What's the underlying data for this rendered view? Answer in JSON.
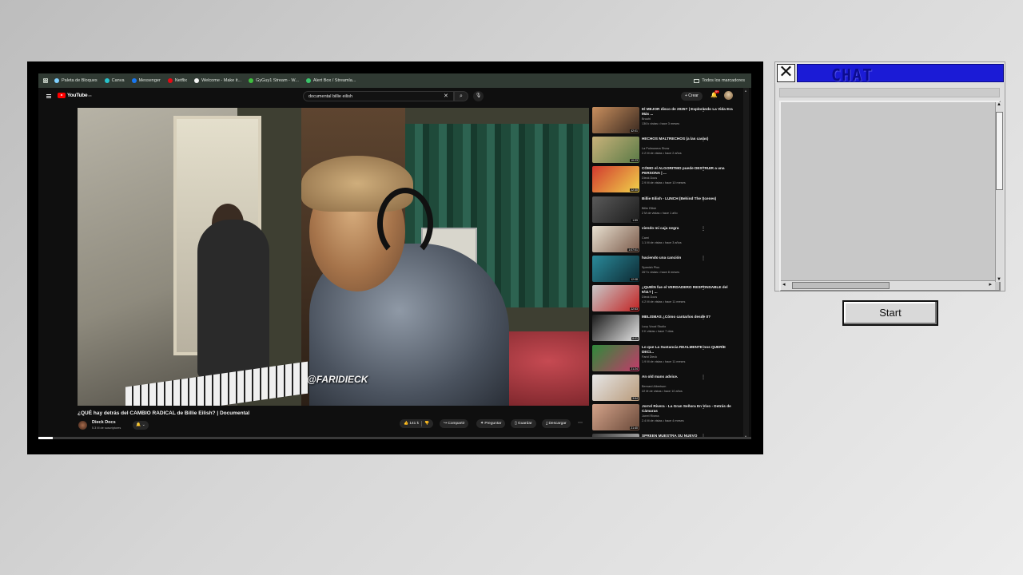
{
  "bookmarks": {
    "items": [
      {
        "label": "Paleta de Bloques",
        "color": "#7fd0ff"
      },
      {
        "label": "Canva",
        "color": "#27c3cc"
      },
      {
        "label": "Messenger",
        "color": "#1877f2"
      },
      {
        "label": "Netflix",
        "color": "#e50914"
      },
      {
        "label": "Welcome - Make it...",
        "color": "#f5f5f5"
      },
      {
        "label": "GyGuy1 Stream - W...",
        "color": "#3fbf3f"
      },
      {
        "label": "Alert Box / Streamla...",
        "color": "#39c56b"
      }
    ],
    "all_label": "Todos los marcadores"
  },
  "youtube": {
    "logo_text": "YouTube",
    "logo_region": "MX",
    "search_value": "documental billie eilish",
    "create_label": "+ Crear",
    "notif_count": "9+",
    "video": {
      "watermark": "@FARIDIECK",
      "title": "¿QUÉ hay detrás del CAMBIO RADICAL de Billie Eilish? | Documental",
      "channel": "Dieck Docs",
      "subscribers": "5.3 M de suscriptores",
      "likes": "141 k",
      "progress_percent": 2
    },
    "actions": {
      "share": "Compartir",
      "ask": "Preguntar",
      "save": "Guardar",
      "download": "Descargar"
    },
    "recommendations": [
      {
        "title": "El MEJOR disco de 2025? | Explorando La Vida Era Más ...",
        "channel": "Bruuhi",
        "meta": "136 k vistas • hace 3 meses",
        "duration": "42:01",
        "colors": [
          "#c98f5e",
          "#3b2a20"
        ]
      },
      {
        "title": "HECHOS MALTRECHOS (a las casas)",
        "channel": "La Pulmonera Show",
        "meta": "2.2 M de vistas • hace 2 años",
        "duration": "10:23",
        "colors": [
          "#c8b27a",
          "#5a7a46"
        ]
      },
      {
        "title": "CÓMO el ALGORITMO puede DESTRUIR a una PERSONA | ...",
        "channel": "Dieck Docs",
        "meta": "2.9 M de vistas • hace 10 meses",
        "duration": "22:30",
        "colors": [
          "#d23a2f",
          "#f0d24a"
        ]
      },
      {
        "title": "Billie Eilish - LUNCH (Behind The Scenes)",
        "channel": "Billie Eilish",
        "meta": "2 M de vistas • hace 1 año",
        "duration": "1:59",
        "colors": [
          "#5a5a5a",
          "#1c1c1c"
        ]
      },
      {
        "title": "viendo mi caja negra",
        "channel": "Cami",
        "meta": "1.1 M de vistas • hace 3 años",
        "duration": "1:07:01",
        "colors": [
          "#e8e0d0",
          "#7a5a4a"
        ]
      },
      {
        "title": "haciendo una canción",
        "channel": "Spanish Plus",
        "meta": "267 k vistas • hace 8 meses",
        "duration": "12:08",
        "colors": [
          "#2a8a9a",
          "#0d2a33"
        ]
      },
      {
        "title": "¿QUIÉN fue el VERDADERO RESPONSABLE del 9/11? | ...",
        "channel": "Dieck Docs",
        "meta": "4.2 M de vistas • hace 11 meses",
        "duration": "22:53",
        "colors": [
          "#c8c8c8",
          "#c22222"
        ]
      },
      {
        "title": "MELISMAS ¿Cómo cantarlos desde 0?",
        "channel": "Lucy Vocal Studio",
        "meta": "3 K vistas • hace 7 días",
        "duration": "8:01",
        "colors": [
          "#1a1a1a",
          "#e6e6e6"
        ]
      },
      {
        "title": "Lo que La Sustancia REALMENTE nos QUERÍE DECI...",
        "channel": "Farid Dieck",
        "meta": "1.9 M de vistas • hace 11 meses",
        "duration": "21:24",
        "colors": [
          "#2e8a3a",
          "#c43a6a"
        ]
      },
      {
        "title": "An old mans advice.",
        "channel": "Bernard Albertson",
        "meta": "22 M de vistas • hace 10 años",
        "duration": "3:54",
        "colors": [
          "#e6e6e6",
          "#b89a7a"
        ]
      },
      {
        "title": "Jorrel Rivera - La Gran Señora En Vivo - Detrás de Cámaras",
        "channel": "Jorrel Rivera",
        "meta": "2.4 M de vistas • hace 4 meses",
        "duration": "21:40",
        "colors": [
          "#d4a38a",
          "#6a4a3a"
        ]
      },
      {
        "title": "SPREEN MUESTRA SU NUEVO",
        "channel": "",
        "meta": "",
        "duration": "",
        "colors": [
          "#3a3a3a",
          "#d0d0d0"
        ]
      }
    ]
  },
  "chat": {
    "title": "CHAT",
    "close_glyph": "✕"
  },
  "start_label": "Start"
}
